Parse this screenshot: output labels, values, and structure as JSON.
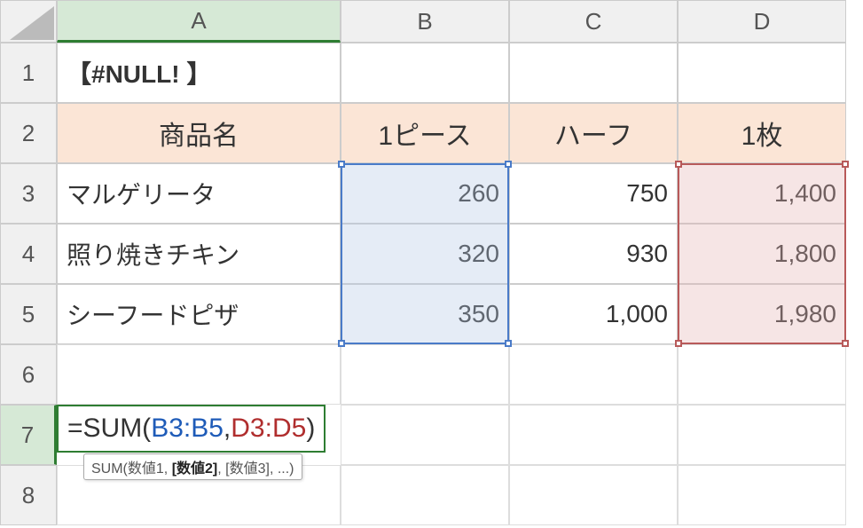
{
  "columns": [
    "A",
    "B",
    "C",
    "D"
  ],
  "rows": [
    "1",
    "2",
    "3",
    "4",
    "5",
    "6",
    "7",
    "8"
  ],
  "title_cell": "【#NULL! 】",
  "headers": {
    "product": "商品名",
    "piece": "1ピース",
    "half": "ハーフ",
    "whole": "1枚"
  },
  "products": [
    {
      "name": "マルゲリータ",
      "piece": "260",
      "half": "750",
      "whole": "1,400"
    },
    {
      "name": "照り焼きチキン",
      "piece": "320",
      "half": "930",
      "whole": "1,800"
    },
    {
      "name": "シーフードピザ",
      "piece": "350",
      "half": "1,000",
      "whole": "1,980"
    }
  ],
  "formula": {
    "prefix": "=SUM(",
    "range1": "B3:B5",
    "comma": ",",
    "range2": "D3:D5",
    "suffix": ")"
  },
  "tooltip": {
    "fn": "SUM(",
    "arg1": "数値1",
    "sep1": ", ",
    "arg2": "[数値2]",
    "sep2": ", ",
    "arg3": "[数値3]",
    "rest": ", ...)"
  },
  "chart_data": {
    "type": "table",
    "title": "【#NULL! 】",
    "columns": [
      "商品名",
      "1ピース",
      "ハーフ",
      "1枚"
    ],
    "rows": [
      [
        "マルゲリータ",
        260,
        750,
        1400
      ],
      [
        "照り焼きチキン",
        320,
        930,
        1800
      ],
      [
        "シーフードピザ",
        350,
        1000,
        1980
      ]
    ],
    "formula": "=SUM(B3:B5,D3:D5)"
  }
}
